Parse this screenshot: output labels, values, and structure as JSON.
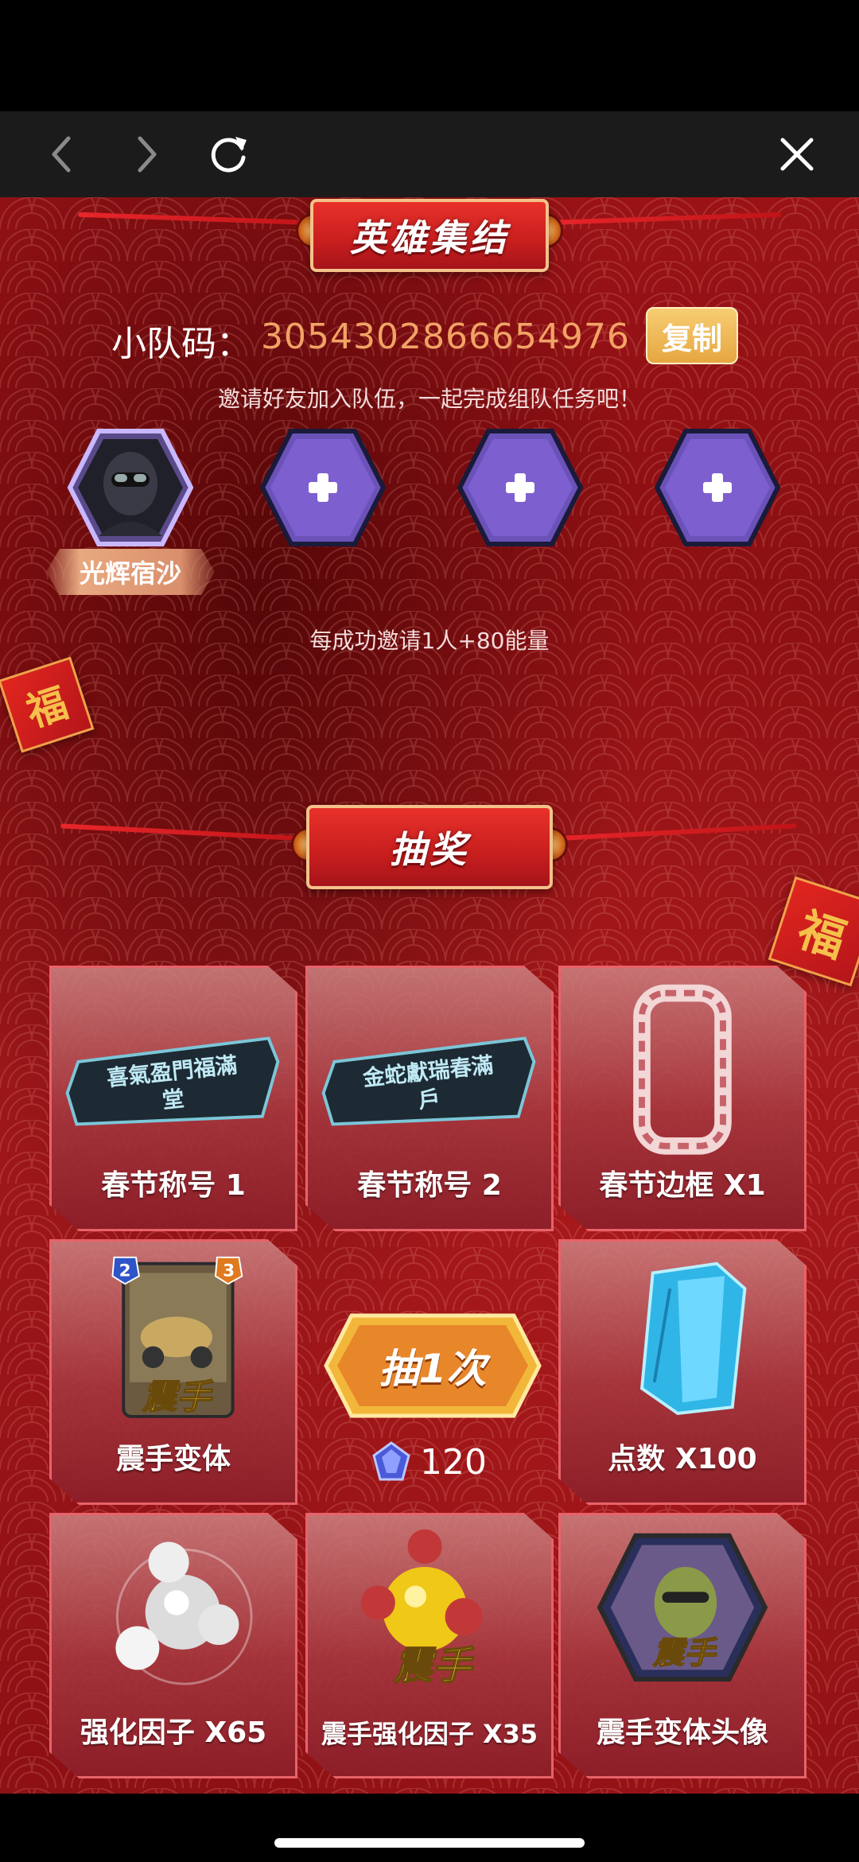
{
  "browser": {
    "back_icon": "chevron-left-icon",
    "forward_icon": "chevron-right-icon",
    "reload_icon": "reload-icon",
    "close_icon": "close-icon"
  },
  "team_section": {
    "title": "英雄集结",
    "team_code_label": "小队码：",
    "team_code_value": "3054302866654976",
    "copy_label": "复制",
    "invite_hint": "邀请好友加入队伍，一起完成组队任务吧！",
    "members": [
      {
        "name": "光辉宿沙",
        "filled": true
      },
      {
        "name": "",
        "filled": false
      },
      {
        "name": "",
        "filled": false
      },
      {
        "name": "",
        "filled": false
      }
    ],
    "reward_hint": "每成功邀请1人+80能量"
  },
  "lottery_section": {
    "title": "抽奖",
    "charm_text": "福",
    "prizes": [
      {
        "label": "春节称号 1",
        "art_text": "喜氣盈門福滿堂"
      },
      {
        "label": "春节称号 2",
        "art_text": "金蛇獻瑞春滿戶"
      },
      {
        "label": "春节边框 X1",
        "art_text": ""
      },
      {
        "label": "震手变体",
        "art_text": "震手",
        "cost_badge": "2",
        "power_badge": "3"
      },
      {
        "label": "点数 X100",
        "art_text": ""
      },
      {
        "label": "强化因子 X65",
        "art_text": ""
      },
      {
        "label": "震手强化因子 X35",
        "art_text": "震手"
      },
      {
        "label": "震手变体头像",
        "art_text": "震手"
      }
    ],
    "draw_button_label": "抽1次",
    "draw_cost": "120"
  },
  "colors": {
    "accent_orange": "#f1a365",
    "copy_button": "#e6a642",
    "background_red": "#9a1216",
    "tile_border": "#e8626a"
  }
}
